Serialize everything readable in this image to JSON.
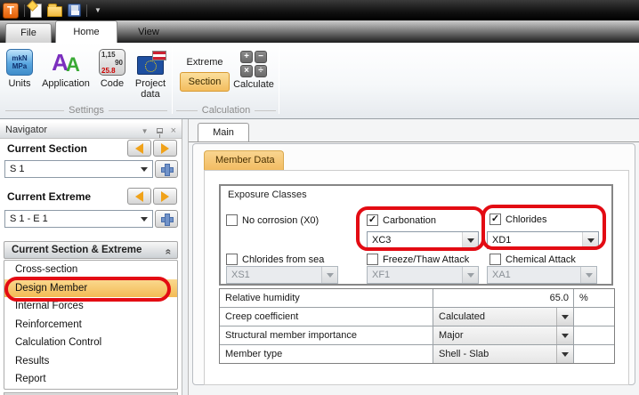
{
  "app": {
    "logo_letter": "T"
  },
  "tabs": {
    "file": "File",
    "home": "Home",
    "view": "View"
  },
  "ribbon": {
    "settings_label": "Settings",
    "calculation_label": "Calculation",
    "units_label": "Units",
    "units_icon_top": "mkN",
    "units_icon_bottom": "MPa",
    "application_label": "Application",
    "code_label": "Code",
    "code_icon_l1": "1,15",
    "code_icon_l2": "90",
    "code_icon_l3": "25.8",
    "project_data_label": "Project data",
    "extreme_label": "Extreme",
    "section_label": "Section",
    "calculate_label": "Calculate",
    "op_plus": "+",
    "op_minus": "−",
    "op_mul": "×",
    "op_div": "÷"
  },
  "navigator": {
    "title": "Navigator",
    "current_section_label": "Current Section",
    "current_section_value": "S 1",
    "current_extreme_label": "Current Extreme",
    "current_extreme_value": "S 1 - E 1",
    "group_header": "Current Section & Extreme",
    "items": [
      {
        "label": "Cross-section",
        "active": false
      },
      {
        "label": "Design Member",
        "active": true
      },
      {
        "label": "Internal Forces",
        "active": false
      },
      {
        "label": "Reinforcement",
        "active": false
      },
      {
        "label": "Calculation Control",
        "active": false
      },
      {
        "label": "Results",
        "active": false
      },
      {
        "label": "Report",
        "active": false
      }
    ]
  },
  "main": {
    "tab_label": "Main",
    "member_tab_label": "Member Data",
    "exposure": {
      "title": "Exposure Classes",
      "no_corrosion_label": "No corrosion (X0)",
      "carbonation_label": "Carbonation",
      "carbonation_value": "XC3",
      "chlorides_label": "Chlorides",
      "chlorides_value": "XD1",
      "chlorides_sea_label": "Chlorides from sea",
      "chlorides_sea_value": "XS1",
      "freeze_label": "Freeze/Thaw Attack",
      "freeze_value": "XF1",
      "chemical_label": "Chemical Attack",
      "chemical_value": "XA1"
    },
    "properties": [
      {
        "label": "Relative humidity",
        "value": "65.0",
        "unit": "%"
      },
      {
        "label": "Creep coefficient",
        "value": "Calculated",
        "unit": ""
      },
      {
        "label": "Structural member importance",
        "value": "Major",
        "unit": ""
      },
      {
        "label": "Member type",
        "value": "Shell - Slab",
        "unit": ""
      }
    ]
  },
  "colors": {
    "accent": "#f3bd5e",
    "highlight_red": "#e30b13"
  }
}
